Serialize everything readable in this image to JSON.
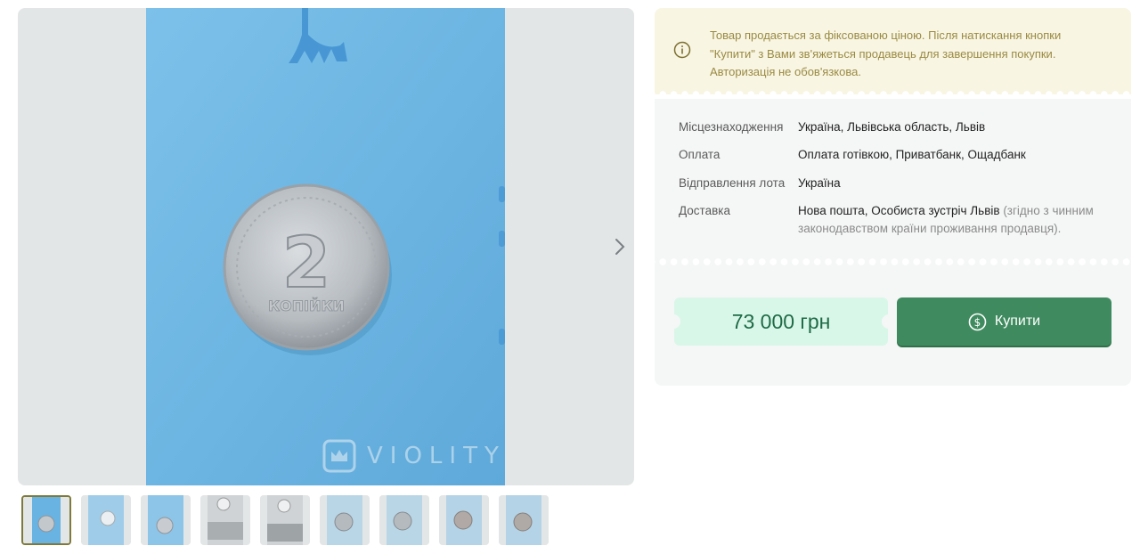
{
  "gallery": {
    "watermark": "VIOLITY",
    "coin_text": {
      "denomination": "2",
      "word": "КОПІЙКИ"
    },
    "thumbnail_count": 9,
    "active_thumbnail": 1
  },
  "notice": {
    "text": "Товар продається за фіксованою ціною. Після натискання кнопки \"Купити\" з Вами зв'яжеться продавець для завершення покупки. Авторизація не обов'язкова.",
    "icon": "info-icon"
  },
  "details": {
    "location_label": "Місцезнаходження",
    "location_value": "Україна, Львівська область, Львів",
    "payment_label": "Оплата",
    "payment_value": "Оплата готівкою, Приватбанк, Ощадбанк",
    "shipping_label": "Відправлення лота",
    "shipping_value": "Україна",
    "delivery_label": "Доставка",
    "delivery_value": "Нова пошта, Особиста зустріч Львів",
    "delivery_note": "(згідно з чинним законодавством країни проживання продавця)."
  },
  "purchase": {
    "price": "73 000 грн",
    "buy_label": "Купити",
    "buy_icon": "dollar-circle-icon"
  },
  "colors": {
    "notice_bg": "#f8f5e3",
    "notice_text": "#9a8a42",
    "price_bg": "#d9f7e8",
    "price_text": "#1e6b46",
    "buy_bg": "#3f8b5f",
    "photo_bg": "#6fb6e3"
  }
}
